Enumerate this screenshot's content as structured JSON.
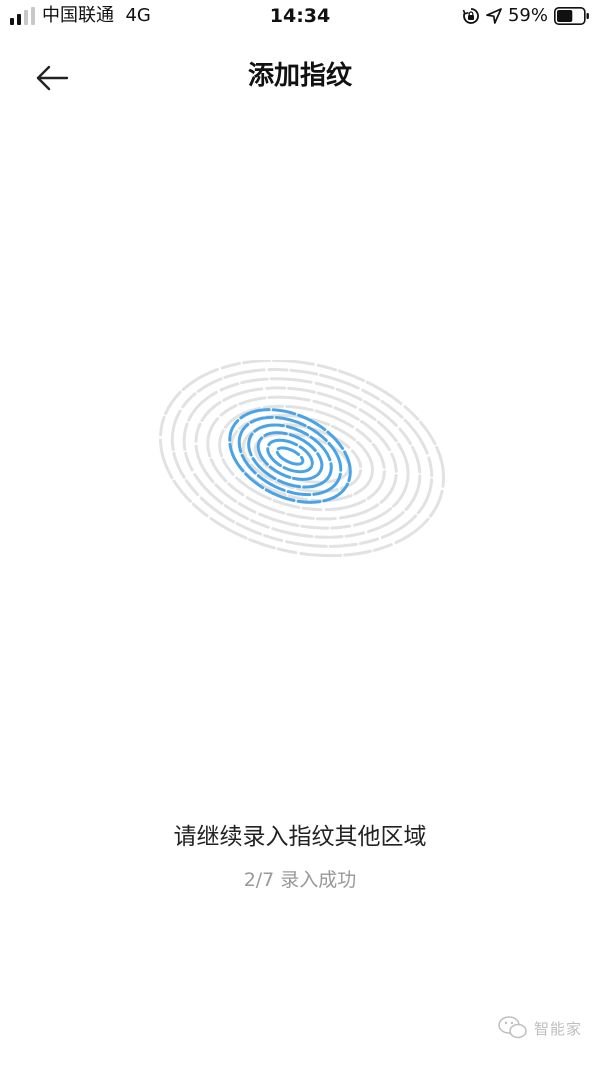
{
  "status_bar": {
    "carrier": "中国联通",
    "network": "4G",
    "time": "14:34",
    "battery_percent": "59%",
    "battery_level": 0.59,
    "icons": [
      "signal-icon",
      "rotation-lock-icon",
      "location-icon",
      "battery-icon"
    ]
  },
  "nav": {
    "title": "添加指纹",
    "back_icon": "back-arrow-icon"
  },
  "fingerprint": {
    "icon": "fingerprint-icon",
    "progress_color": "#4aa3e6",
    "inactive_color": "#e2e2e2"
  },
  "enroll": {
    "prompt": "请继续录入指纹其他区域",
    "progress_text": "2/7 录入成功",
    "progress_fraction": 0.2857
  },
  "watermark": {
    "text": "智能家",
    "icon": "wechat-icon"
  }
}
